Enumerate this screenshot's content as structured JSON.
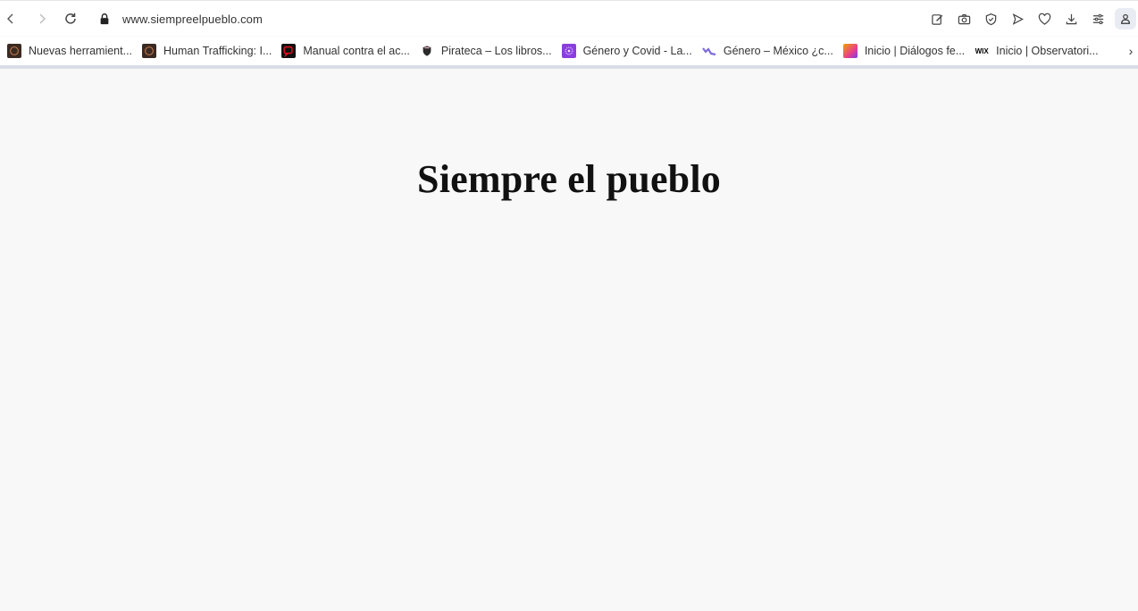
{
  "browser": {
    "url": "www.siempreelpueblo.com",
    "nav": {
      "back_icon": "chevron-left-icon",
      "forward_icon": "chevron-right-icon",
      "reload_icon": "reload-icon"
    },
    "right_icons": [
      "edit-icon",
      "camera-icon",
      "shield-icon",
      "send-icon",
      "heart-icon",
      "download-icon",
      "menu-icon",
      "profile-icon"
    ]
  },
  "bookmarks": [
    {
      "label": "Nuevas herramient...",
      "icon": "dark-circle-icon",
      "color": "#3b2a22"
    },
    {
      "label": "Human Trafficking: I...",
      "icon": "dark-circle-icon",
      "color": "#3b2a22"
    },
    {
      "label": "Manual contra el ac...",
      "icon": "red-square-icon",
      "color": "#b0101a"
    },
    {
      "label": "Pirateca – Los libros...",
      "icon": "shield-icon",
      "color": "#222222"
    },
    {
      "label": "Género y Covid - La...",
      "icon": "purple-flower-icon",
      "color": "#8a3ee0"
    },
    {
      "label": "Género – México ¿c...",
      "icon": "wave-icon",
      "color": "#7d6cd8"
    },
    {
      "label": "Inicio | Diálogos fe...",
      "icon": "colorful-square-icon",
      "color": "#f2a100"
    },
    {
      "label": "Inicio | Observatori...",
      "icon": "wix-icon",
      "color": "#000000"
    }
  ],
  "page": {
    "title": "Siempre el pueblo"
  },
  "colors": {
    "page_background": "#f8f8f8",
    "toolbar_background": "#ffffff"
  }
}
